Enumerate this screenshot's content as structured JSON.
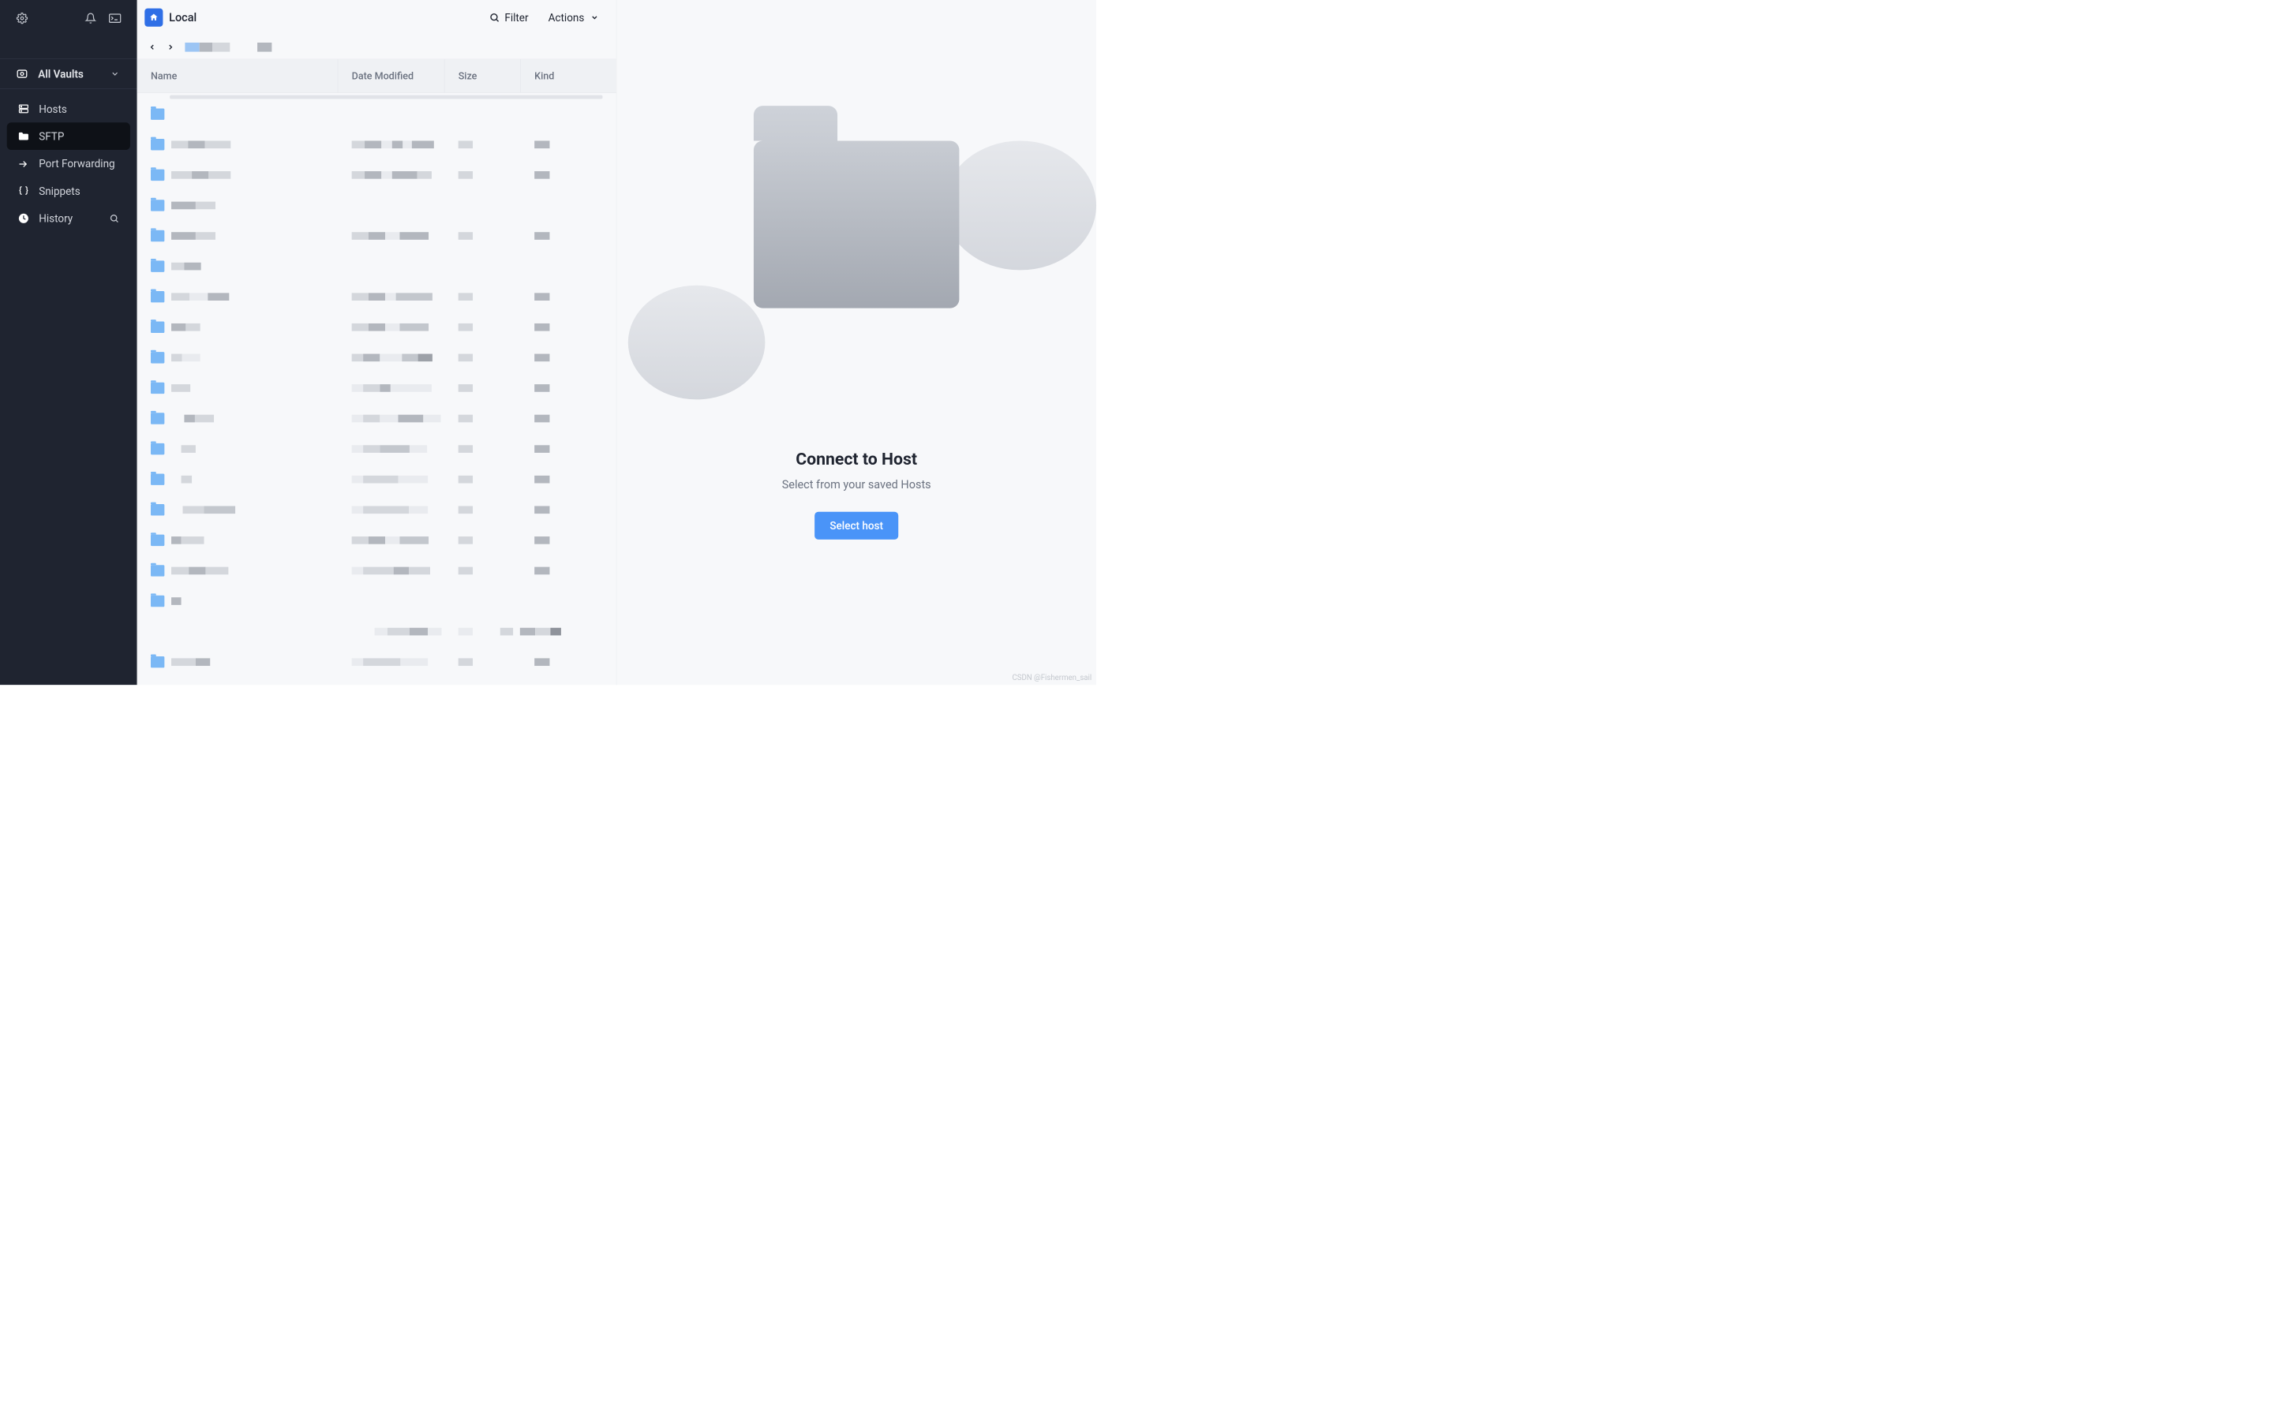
{
  "sidebar": {
    "vault_label": "All Vaults",
    "nav": [
      {
        "label": "Hosts",
        "icon": "server-icon"
      },
      {
        "label": "SFTP",
        "icon": "folder-icon"
      },
      {
        "label": "Port Forwarding",
        "icon": "arrow-forward-icon"
      },
      {
        "label": "Snippets",
        "icon": "braces-icon"
      },
      {
        "label": "History",
        "icon": "clock-icon"
      }
    ]
  },
  "panel": {
    "home_label": "Local",
    "filter_label": "Filter",
    "actions_label": "Actions",
    "columns": {
      "name": "Name",
      "date": "Date Modified",
      "size": "Size",
      "kind": "Kind"
    }
  },
  "right": {
    "title": "Connect to Host",
    "subtitle": "Select from your saved Hosts",
    "button": "Select host"
  },
  "watermark": "CSDN @Fishermen_sail"
}
